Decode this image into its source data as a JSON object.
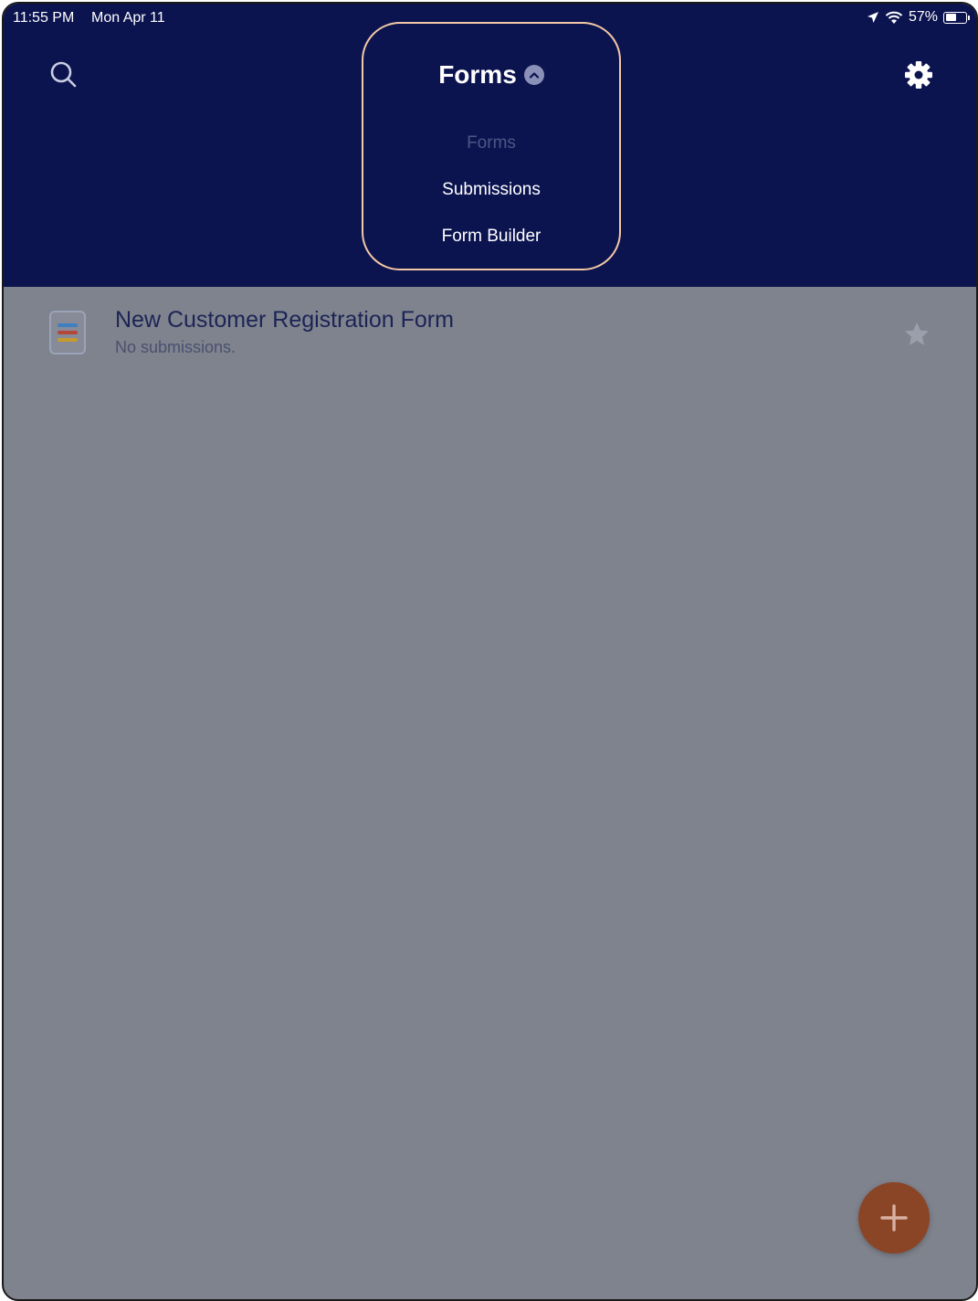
{
  "status_bar": {
    "time": "11:55 PM",
    "date": "Mon Apr 11",
    "battery": "57%",
    "battery_level": 0.57
  },
  "header": {
    "search_icon": "search-icon",
    "settings_icon": "gear-icon",
    "nav_title": "Forms",
    "nav_options": [
      {
        "label": "Forms",
        "selected": true
      },
      {
        "label": "Submissions",
        "selected": false
      },
      {
        "label": "Form Builder",
        "selected": false
      }
    ]
  },
  "forms_list": [
    {
      "title": "New Customer Registration Form",
      "subtitle": "No submissions.",
      "icon": "form-document-icon",
      "favorite_icon": "star-icon"
    }
  ],
  "fab": {
    "icon": "plus-icon"
  },
  "colors": {
    "header": "#0c1450",
    "overlay": "#7f838d",
    "dropdown_outline": "#f3c8a5",
    "fab": "#8a4526",
    "icon_bar_blue": "#3e7fc1",
    "icon_bar_red": "#b5463a",
    "icon_bar_yellow": "#c79a2e"
  }
}
